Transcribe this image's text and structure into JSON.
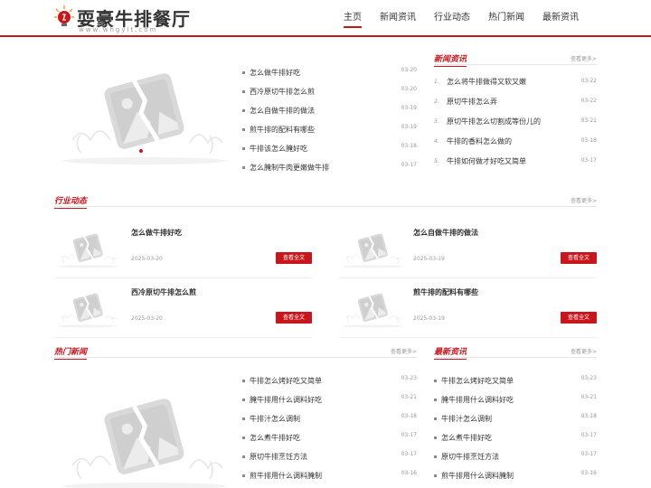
{
  "header": {
    "logo_title": "耍豪牛排餐厅",
    "logo_sub": "www.whgylt.com",
    "nav": [
      "主页",
      "新闻资讯",
      "行业动态",
      "热门新闻",
      "最新资讯"
    ]
  },
  "colors": {
    "accent": "#c8161d",
    "text": "#333333",
    "muted": "#999999"
  },
  "top_list": [
    {
      "title": "怎么做牛排好吃",
      "date": "03-20"
    },
    {
      "title": "西冷原切牛排怎么煎",
      "date": "03-20"
    },
    {
      "title": "怎么自做牛排的做法",
      "date": "03-19"
    },
    {
      "title": "煎牛排的配料有哪些",
      "date": "03-19"
    },
    {
      "title": "牛排该怎么腌好吃",
      "date": "03-18"
    },
    {
      "title": "怎么腌制牛肉更嫩做牛排",
      "date": "03-17"
    }
  ],
  "news": {
    "title": "新闻资讯",
    "more": "查看更多>",
    "items": [
      {
        "num": "1.",
        "title": "怎么将牛排做得又软又嫩",
        "date": "03-22"
      },
      {
        "num": "2.",
        "title": "原切牛排怎么弄",
        "date": "03-22"
      },
      {
        "num": "3.",
        "title": "原切牛排怎么切割成等份儿的",
        "date": "03-21"
      },
      {
        "num": "4.",
        "title": "牛排的香料怎么做的",
        "date": "03-18"
      },
      {
        "num": "5.",
        "title": "牛排如何做才好吃又简单",
        "date": "03-17"
      }
    ]
  },
  "industry": {
    "title": "行业动态",
    "more": "查看更多>",
    "cards": [
      {
        "title": "怎么做牛排好吃",
        "date": "2025-03-20",
        "button": "查看全文"
      },
      {
        "title": "怎么自做牛排的做法",
        "date": "2025-03-19",
        "button": "查看全文"
      },
      {
        "title": "西冷原切牛排怎么煎",
        "date": "2025-03-20",
        "button": "查看全文"
      },
      {
        "title": "煎牛排的配料有哪些",
        "date": "2025-03-19",
        "button": "查看全文"
      }
    ]
  },
  "hot": {
    "title": "热门新闻",
    "more": "查看更多>",
    "items": [
      {
        "title": "牛排怎么烤好吃又简单",
        "date": "03-23"
      },
      {
        "title": "腌牛排用什么调料好吃",
        "date": "03-21"
      },
      {
        "title": "牛排汁怎么调制",
        "date": "03-18"
      },
      {
        "title": "怎么煮牛排好吃",
        "date": "03-17"
      },
      {
        "title": "原切牛排烹饪方法",
        "date": "03-17"
      },
      {
        "title": "煎牛排用什么调料腌制",
        "date": "03-16"
      }
    ]
  },
  "latest": {
    "title": "最新资讯",
    "more": "查看更多>",
    "items": [
      {
        "title": "牛排怎么烤好吃又简单",
        "date": "03-23"
      },
      {
        "title": "腌牛排用什么调料好吃",
        "date": "03-21"
      },
      {
        "title": "牛排汁怎么调制",
        "date": "03-18"
      },
      {
        "title": "怎么煮牛排好吃",
        "date": "03-17"
      },
      {
        "title": "原切牛排烹饪方法",
        "date": "03-17"
      },
      {
        "title": "煎牛排用什么调料腌制",
        "date": "03-16"
      }
    ]
  }
}
